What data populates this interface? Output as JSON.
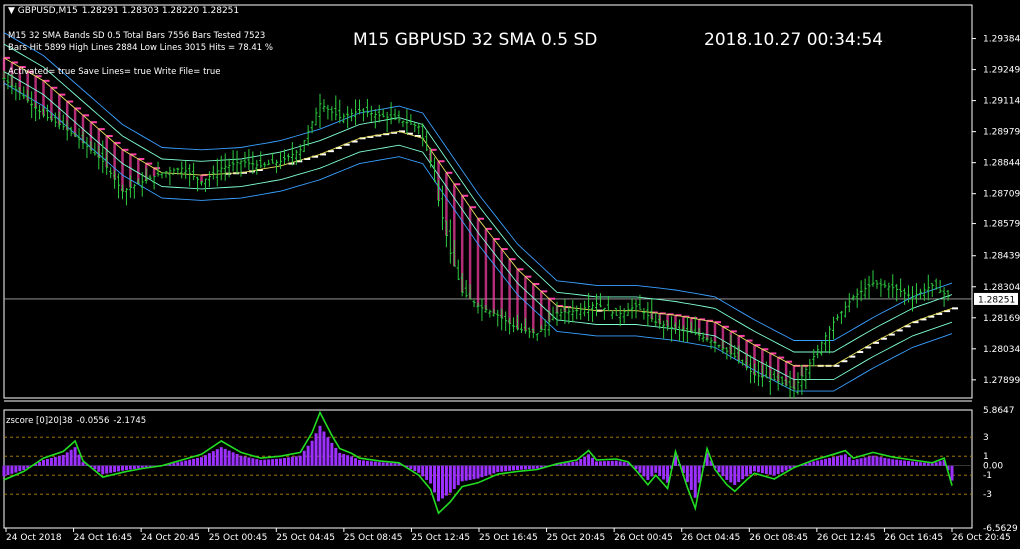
{
  "window": {
    "symbol_header": "GBPUSD,M15",
    "ohlc": "1.28291 1.28303 1.28220 1.28251",
    "info_line1": "M15  32 SMA   Bands SD 0.5   Total Bars 7556   Bars Tested 7523",
    "info_line2": "Bars Hit 5899   High Lines 2884   Low Lines 3015   Hits = 78.41 %",
    "info_line3": "Activated= true   Save Lines= true   Write File= true",
    "title_main": "M15   GBPUSD  32 SMA  0.5 SD",
    "title_time": "2018.10.27 00:34:54"
  },
  "colors": {
    "background": "#000000",
    "candle": "#2ecc40",
    "sma_band_fill": "#ff3fa8",
    "high_lines": "#ffffff",
    "band_yellow": "#e8e060",
    "band_aqua": "#7fffd4",
    "band_blue": "#3aa0ff",
    "zscore_line": "#22dd22",
    "zscore_hist": "#9b30ff",
    "level_dash": "#b8860b"
  },
  "chart_data": [
    {
      "type": "candlestick",
      "title": "GBPUSD,M15",
      "current_price": "1.28251",
      "current_price_value": 1.28251,
      "ylim": [
        1.2782,
        1.2953
      ],
      "y_ticks": [
        "1.29384",
        "1.29249",
        "1.29114",
        "1.28979",
        "1.28844",
        "1.28709",
        "1.28579",
        "1.28439",
        "1.28304",
        "1.28169",
        "1.28034",
        "1.27899"
      ],
      "y_tick_values": [
        1.29384,
        1.29249,
        1.29114,
        1.28979,
        1.28844,
        1.28709,
        1.28579,
        1.28439,
        1.28304,
        1.28169,
        1.28034,
        1.27899
      ],
      "x_ticks": [
        "24 Oct 2018",
        "24 Oct 16:45",
        "24 Oct 20:45",
        "25 Oct 00:45",
        "25 Oct 04:45",
        "25 Oct 08:45",
        "25 Oct 12:45",
        "25 Oct 16:45",
        "25 Oct 20:45",
        "26 Oct 00:45",
        "26 Oct 04:45",
        "26 Oct 08:45",
        "26 Oct 12:45",
        "26 Oct 16:45",
        "26 Oct 20:45"
      ],
      "close_path": [
        [
          0,
          1.2921
        ],
        [
          5,
          1.2913
        ],
        [
          10,
          1.2905
        ],
        [
          15,
          1.29
        ],
        [
          20,
          1.2893
        ],
        [
          25,
          1.2885
        ],
        [
          30,
          1.2872
        ],
        [
          35,
          1.2876
        ],
        [
          40,
          1.288
        ],
        [
          45,
          1.2882
        ],
        [
          50,
          1.2876
        ],
        [
          55,
          1.2882
        ],
        [
          60,
          1.2885
        ],
        [
          65,
          1.2883
        ],
        [
          70,
          1.2885
        ],
        [
          75,
          1.289
        ],
        [
          80,
          1.291
        ],
        [
          85,
          1.2904
        ],
        [
          90,
          1.2907
        ],
        [
          95,
          1.2905
        ],
        [
          100,
          1.2903
        ],
        [
          105,
          1.29
        ],
        [
          108,
          1.2885
        ],
        [
          110,
          1.2868
        ],
        [
          113,
          1.2845
        ],
        [
          116,
          1.2828
        ],
        [
          120,
          1.2822
        ],
        [
          125,
          1.2818
        ],
        [
          130,
          1.2812
        ],
        [
          135,
          1.281
        ],
        [
          140,
          1.2819
        ],
        [
          145,
          1.282
        ],
        [
          150,
          1.2823
        ],
        [
          155,
          1.2818
        ],
        [
          160,
          1.2822
        ],
        [
          165,
          1.2815
        ],
        [
          170,
          1.2812
        ],
        [
          175,
          1.281
        ],
        [
          180,
          1.2806
        ],
        [
          185,
          1.28
        ],
        [
          190,
          1.2792
        ],
        [
          195,
          1.279
        ],
        [
          200,
          1.2786
        ],
        [
          205,
          1.28
        ],
        [
          210,
          1.2815
        ],
        [
          215,
          1.2826
        ],
        [
          220,
          1.2832
        ],
        [
          225,
          1.283
        ],
        [
          230,
          1.2826
        ],
        [
          235,
          1.2831
        ],
        [
          240,
          1.2825
        ]
      ],
      "bands_mid": [
        [
          0,
          1.293
        ],
        [
          10,
          1.292
        ],
        [
          20,
          1.2905
        ],
        [
          30,
          1.289
        ],
        [
          40,
          1.288
        ],
        [
          50,
          1.2879
        ],
        [
          60,
          1.288
        ],
        [
          70,
          1.2883
        ],
        [
          80,
          1.2888
        ],
        [
          90,
          1.2895
        ],
        [
          100,
          1.2898
        ],
        [
          106,
          1.2895
        ],
        [
          110,
          1.2885
        ],
        [
          120,
          1.286
        ],
        [
          130,
          1.2838
        ],
        [
          140,
          1.2822
        ],
        [
          150,
          1.282
        ],
        [
          160,
          1.282
        ],
        [
          170,
          1.2818
        ],
        [
          180,
          1.2815
        ],
        [
          190,
          1.2805
        ],
        [
          200,
          1.2796
        ],
        [
          210,
          1.2796
        ],
        [
          220,
          1.2806
        ],
        [
          230,
          1.2815
        ],
        [
          240,
          1.2821
        ]
      ],
      "zscore": {
        "title": "zscore [0]20|38",
        "current_value": "-0.0556",
        "current_signal": "-2.1745",
        "ylim": [
          -6.5629,
          5.8647
        ],
        "y_ticks": [
          "5.8647",
          "3",
          "1",
          "0.00",
          "-1",
          "-3",
          "-6.5629"
        ],
        "y_tick_values": [
          5.8647,
          3,
          1,
          0,
          -1,
          -3,
          -6.5629
        ],
        "levels": [
          3,
          1,
          -1,
          -3
        ],
        "values": [
          [
            0,
            -1.5
          ],
          [
            5,
            -0.6
          ],
          [
            10,
            0.8
          ],
          [
            15,
            1.5
          ],
          [
            18,
            2.6
          ],
          [
            20,
            0.5
          ],
          [
            25,
            -1.2
          ],
          [
            30,
            -0.7
          ],
          [
            35,
            -0.3
          ],
          [
            40,
            0.0
          ],
          [
            45,
            0.6
          ],
          [
            50,
            1.2
          ],
          [
            55,
            2.6
          ],
          [
            60,
            1.4
          ],
          [
            65,
            0.8
          ],
          [
            70,
            1.0
          ],
          [
            75,
            1.4
          ],
          [
            78,
            3.5
          ],
          [
            80,
            5.6
          ],
          [
            83,
            3.2
          ],
          [
            85,
            1.8
          ],
          [
            88,
            1.3
          ],
          [
            90,
            0.8
          ],
          [
            95,
            0.5
          ],
          [
            100,
            0.3
          ],
          [
            105,
            -1.0
          ],
          [
            108,
            -2.5
          ],
          [
            110,
            -5.0
          ],
          [
            113,
            -3.8
          ],
          [
            116,
            -2.2
          ],
          [
            120,
            -1.8
          ],
          [
            125,
            -0.9
          ],
          [
            130,
            -0.6
          ],
          [
            135,
            -0.4
          ],
          [
            140,
            0.2
          ],
          [
            145,
            0.6
          ],
          [
            148,
            1.6
          ],
          [
            150,
            0.6
          ],
          [
            155,
            0.7
          ],
          [
            158,
            0.4
          ],
          [
            160,
            -0.5
          ],
          [
            163,
            -2.0
          ],
          [
            165,
            -1.0
          ],
          [
            168,
            -2.4
          ],
          [
            170,
            1.5
          ],
          [
            173,
            -2.3
          ],
          [
            175,
            -4.5
          ],
          [
            178,
            1.8
          ],
          [
            180,
            -0.4
          ],
          [
            183,
            -2.0
          ],
          [
            185,
            -2.7
          ],
          [
            188,
            -1.5
          ],
          [
            190,
            -0.8
          ],
          [
            195,
            -1.4
          ],
          [
            200,
            -0.2
          ],
          [
            205,
            0.6
          ],
          [
            210,
            1.2
          ],
          [
            213,
            1.6
          ],
          [
            215,
            0.8
          ],
          [
            220,
            1.4
          ],
          [
            225,
            0.9
          ],
          [
            230,
            0.6
          ],
          [
            235,
            0.3
          ],
          [
            238,
            0.8
          ],
          [
            240,
            -2.1
          ]
        ]
      }
    }
  ]
}
